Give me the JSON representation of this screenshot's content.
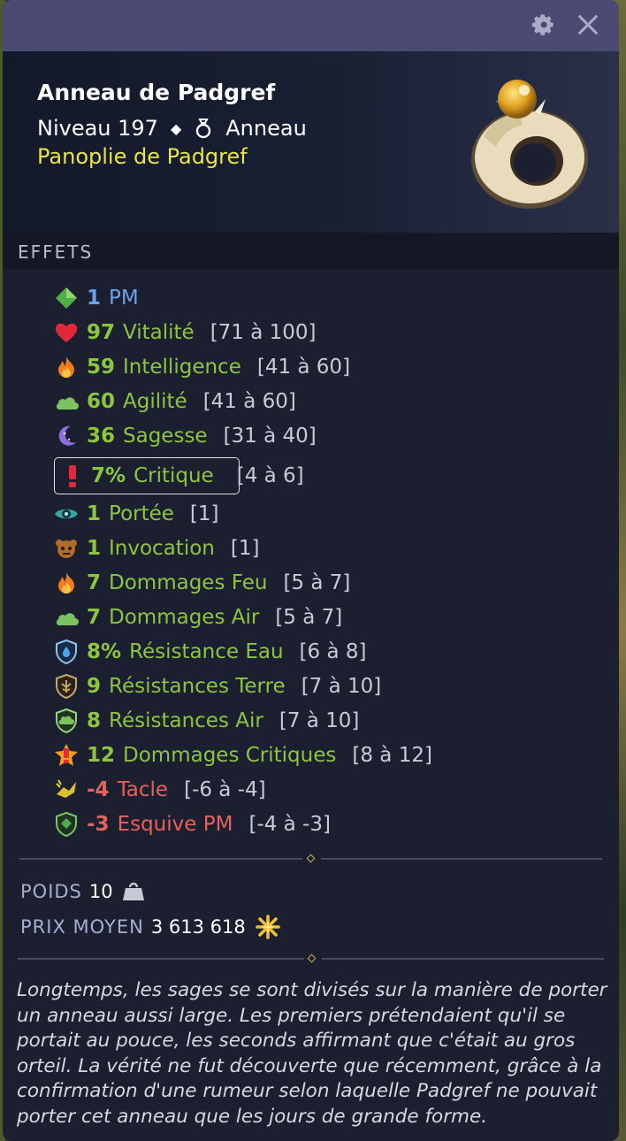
{
  "item": {
    "name": "Anneau de Padgref",
    "level": "Niveau 197",
    "type": "Anneau",
    "set": "Panoplie de Padgref"
  },
  "effects_title": "EFFETS",
  "effects": [
    {
      "icon": "pm-diamond-icon",
      "value": "1",
      "label": "PM",
      "range": ""
    },
    {
      "icon": "heart-icon",
      "value": "97",
      "label": "Vitalité",
      "range": "[71 à 100]"
    },
    {
      "icon": "fire-icon",
      "value": "59",
      "label": "Intelligence",
      "range": "[41 à 60]"
    },
    {
      "icon": "cloud-icon",
      "value": "60",
      "label": "Agilité",
      "range": "[41 à 60]"
    },
    {
      "icon": "moon-icon",
      "value": "36",
      "label": "Sagesse",
      "range": "[31 à 40]"
    },
    {
      "icon": "critical-icon",
      "value": "7%",
      "label": "Critique",
      "range": "[4 à 6]"
    },
    {
      "icon": "eye-icon",
      "value": "1",
      "label": "Portée",
      "range": "[1]"
    },
    {
      "icon": "invocation-icon",
      "value": "1",
      "label": "Invocation",
      "range": "[1]"
    },
    {
      "icon": "fire-icon",
      "value": "7",
      "label": "Dommages Feu",
      "range": "[5 à 7]"
    },
    {
      "icon": "cloud-icon",
      "value": "7",
      "label": "Dommages Air",
      "range": "[5 à 7]"
    },
    {
      "icon": "shield-water-icon",
      "value": "8%",
      "label": "Résistance Eau",
      "range": "[6 à 8]"
    },
    {
      "icon": "shield-earth-icon",
      "value": "9",
      "label": "Résistances Terre",
      "range": "[7 à 10]"
    },
    {
      "icon": "shield-air-icon",
      "value": "8",
      "label": "Résistances Air",
      "range": "[7 à 10]"
    },
    {
      "icon": "critical-damage-icon",
      "value": "12",
      "label": "Dommages Critiques",
      "range": "[8 à 12]"
    },
    {
      "icon": "tackle-icon",
      "value": "-4",
      "label": "Tacle",
      "range": "[-6 à -4]"
    },
    {
      "icon": "dodge-pm-icon",
      "value": "-3",
      "label": "Esquive PM",
      "range": "[-4 à -3]"
    }
  ],
  "weight": {
    "label": "POIDS",
    "value": "10"
  },
  "price": {
    "label": "PRIX MOYEN",
    "value": "3 613 618"
  },
  "description": "Longtemps, les sages se sont divisés sur la manière de porter un anneau aussi large. Les premiers prétendaient qu'il se portait au pouce, les seconds affirmant que c'était au gros orteil. La vérité ne fut découverte que récemment, grâce à la confirmation d'une rumeur selon laquelle Padgref ne pouvait porter cet anneau que les jours de grande forme."
}
